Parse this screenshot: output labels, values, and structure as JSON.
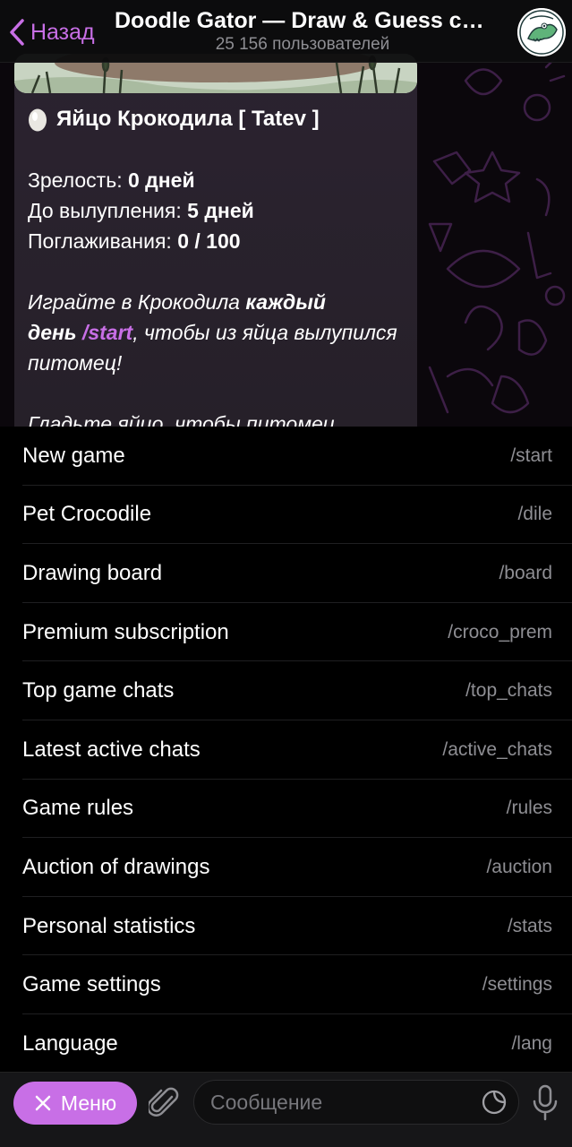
{
  "header": {
    "back_label": "Назад",
    "title": "Doodle Gator — Draw & Guess ch...",
    "subtitle": "25 156 пользователей",
    "back_icon": "chevron-left-icon",
    "avatar_icon": "crocodile-avatar-icon"
  },
  "message": {
    "egg_title": "Яйцо Крокодила [ Tatev ]",
    "maturity_label": "Зрелость: ",
    "maturity_value": "0 дней",
    "hatch_label": "До вылупления: ",
    "hatch_value": "5 дней",
    "pets_label": "Поглаживания: ",
    "pets_value": "0 / 100",
    "play_prefix": "Играйте в Крокодила ",
    "play_bold1": "каждый",
    "play_bold2": "день",
    "play_cmd": "/start",
    "play_suffix": ", чтобы из яйца вылупился питомец!",
    "cut_text": "Гладьте яйцо, чтобы питомец"
  },
  "commands": [
    {
      "label": "New game",
      "cmd": "/start"
    },
    {
      "label": "Pet Crocodile",
      "cmd": "/dile"
    },
    {
      "label": "Drawing board",
      "cmd": "/board"
    },
    {
      "label": "Premium subscription",
      "cmd": "/croco_prem"
    },
    {
      "label": "Top game chats",
      "cmd": "/top_chats"
    },
    {
      "label": "Latest active chats",
      "cmd": "/active_chats"
    },
    {
      "label": "Game rules",
      "cmd": "/rules"
    },
    {
      "label": "Auction of drawings",
      "cmd": "/auction"
    },
    {
      "label": "Personal statistics",
      "cmd": "/stats"
    },
    {
      "label": "Game settings",
      "cmd": "/settings"
    },
    {
      "label": "Language",
      "cmd": "/lang"
    }
  ],
  "input_bar": {
    "menu_label": "Меню",
    "placeholder": "Сообщение"
  },
  "colors": {
    "accent": "#c86fe6",
    "background": "#000000",
    "muted": "#8e8e93"
  }
}
